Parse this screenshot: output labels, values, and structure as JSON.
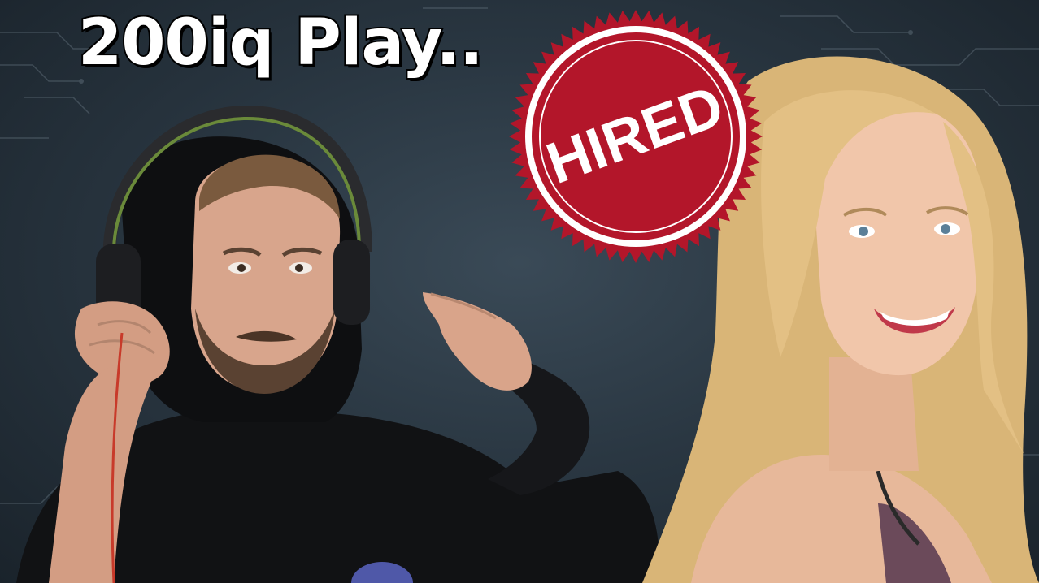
{
  "thumbnail": {
    "title": "200iq Play..",
    "stamp_text": "HIRED",
    "colors": {
      "background": "#2a3742",
      "title_fill": "#ffffff",
      "title_outline": "#000000",
      "stamp_red": "#b3162a",
      "stamp_text": "#ffffff"
    }
  }
}
